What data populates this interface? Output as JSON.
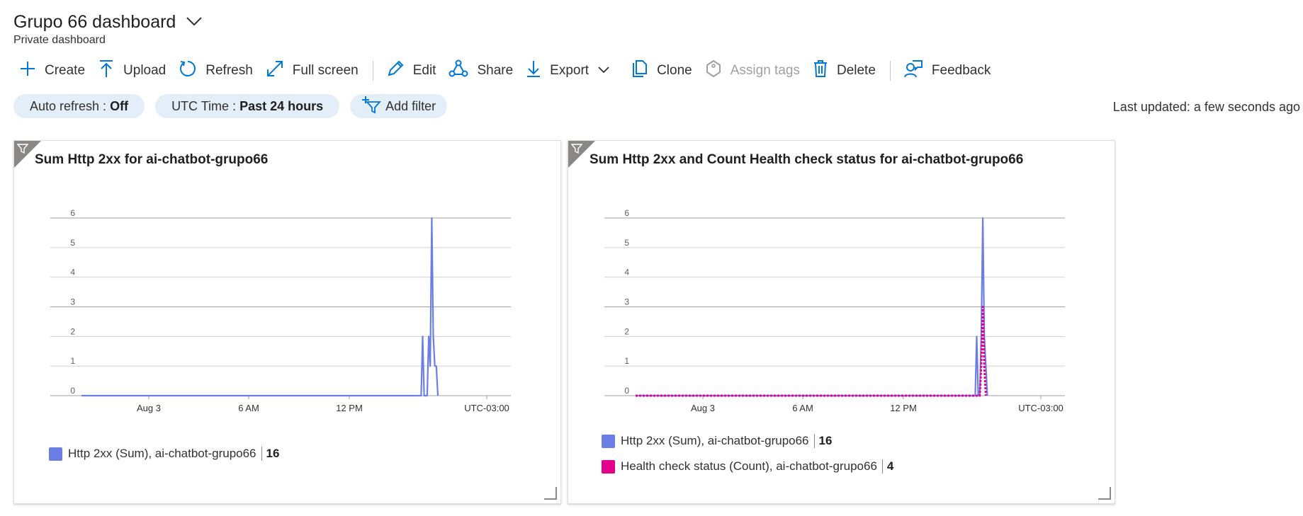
{
  "header": {
    "title": "Grupo 66 dashboard",
    "subtitle": "Private dashboard"
  },
  "toolbar": {
    "create": "Create",
    "upload": "Upload",
    "refresh": "Refresh",
    "fullscreen": "Full screen",
    "edit": "Edit",
    "share": "Share",
    "export": "Export",
    "clone": "Clone",
    "assign_tags": "Assign tags",
    "delete": "Delete",
    "feedback": "Feedback"
  },
  "filters": {
    "auto_refresh_label": "Auto refresh : ",
    "auto_refresh_value": "Off",
    "time_label": "UTC Time : ",
    "time_value": "Past 24 hours",
    "add_filter": "Add filter"
  },
  "last_updated": "Last updated: a few seconds ago",
  "colors": {
    "http_series": "#6b7ee6",
    "health_series": "#e3008c",
    "accent": "#0078d4",
    "pill_bg": "#e3eef9"
  },
  "chart_data": [
    {
      "type": "line",
      "title": "Sum Http 2xx for ai-chatbot-grupo66",
      "x_ticks": [
        "Aug 3",
        "6 AM",
        "12 PM",
        "UTC-03:00"
      ],
      "y_ticks": [
        "0",
        "1",
        "2",
        "3",
        "4",
        "5",
        "6"
      ],
      "ylim": [
        0,
        6
      ],
      "grid": true,
      "legend_position": "bottom-left",
      "series": [
        {
          "name": "Http 2xx (Sum), ai-chatbot-grupo66",
          "total": "16",
          "color": "#6b7ee6",
          "dash": false,
          "points": [
            [
              0,
              0
            ],
            [
              0.8485,
              0
            ],
            [
              0.8523,
              2
            ],
            [
              0.856,
              0
            ],
            [
              0.8636,
              0
            ],
            [
              0.8674,
              2
            ],
            [
              0.8712,
              1
            ],
            [
              0.875,
              6
            ],
            [
              0.8788,
              2
            ],
            [
              0.8826,
              1
            ],
            [
              0.8864,
              1
            ],
            [
              0.8902,
              0
            ]
          ]
        }
      ]
    },
    {
      "type": "line",
      "title": "Sum Http 2xx and Count Health check status for ai-chatbot-grupo66",
      "x_ticks": [
        "Aug 3",
        "6 AM",
        "12 PM",
        "UTC-03:00"
      ],
      "y_ticks": [
        "0",
        "1",
        "2",
        "3",
        "4",
        "5",
        "6"
      ],
      "ylim": [
        0,
        6
      ],
      "grid": true,
      "legend_position": "bottom-left",
      "series": [
        {
          "name": "Http 2xx (Sum), ai-chatbot-grupo66",
          "total": "16",
          "color": "#6b7ee6",
          "dash": false,
          "points": [
            [
              0,
              0
            ],
            [
              0.8485,
              0
            ],
            [
              0.8523,
              2
            ],
            [
              0.856,
              0
            ],
            [
              0.8598,
              0
            ],
            [
              0.8636,
              2
            ],
            [
              0.8674,
              6
            ],
            [
              0.8712,
              2
            ],
            [
              0.875,
              1
            ],
            [
              0.8788,
              0
            ]
          ]
        },
        {
          "name": "Health check status (Count), ai-chatbot-grupo66",
          "total": "4",
          "color": "#e3008c",
          "dash": true,
          "points": [
            [
              0,
              0
            ],
            [
              0.8598,
              0
            ],
            [
              0.8636,
              1
            ],
            [
              0.8674,
              3
            ],
            [
              0.8712,
              1
            ],
            [
              0.875,
              0
            ]
          ]
        }
      ]
    }
  ]
}
